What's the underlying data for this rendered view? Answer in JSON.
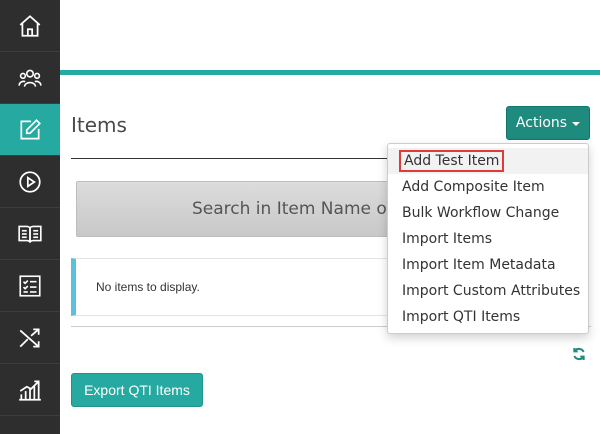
{
  "sidebar": {
    "items": [
      {
        "icon": "home-icon",
        "active": false
      },
      {
        "icon": "users-icon",
        "active": false
      },
      {
        "icon": "edit-icon",
        "active": true
      },
      {
        "icon": "play-icon",
        "active": false
      },
      {
        "icon": "book-icon",
        "active": false
      },
      {
        "icon": "checklist-icon",
        "active": false
      },
      {
        "icon": "shuffle-icon",
        "active": false
      },
      {
        "icon": "chart-icon",
        "active": false
      }
    ]
  },
  "page": {
    "title": "Items",
    "actions_label": "Actions",
    "search_placeholder": "Search in Item Name or",
    "empty_message": "No items to display.",
    "export_label": "Export QTI Items"
  },
  "dropdown": {
    "items": [
      "Add Test Item",
      "Add Composite Item",
      "Bulk Workflow Change",
      "Import Items",
      "Import Item Metadata",
      "Import Custom Attributes",
      "Import QTI Items"
    ],
    "highlighted_index": 0
  },
  "colors": {
    "sidebar_bg": "#2e2e2e",
    "accent": "#26a9a0",
    "actions_bg": "#1f8a7e",
    "highlight_border": "#e03a3a"
  }
}
